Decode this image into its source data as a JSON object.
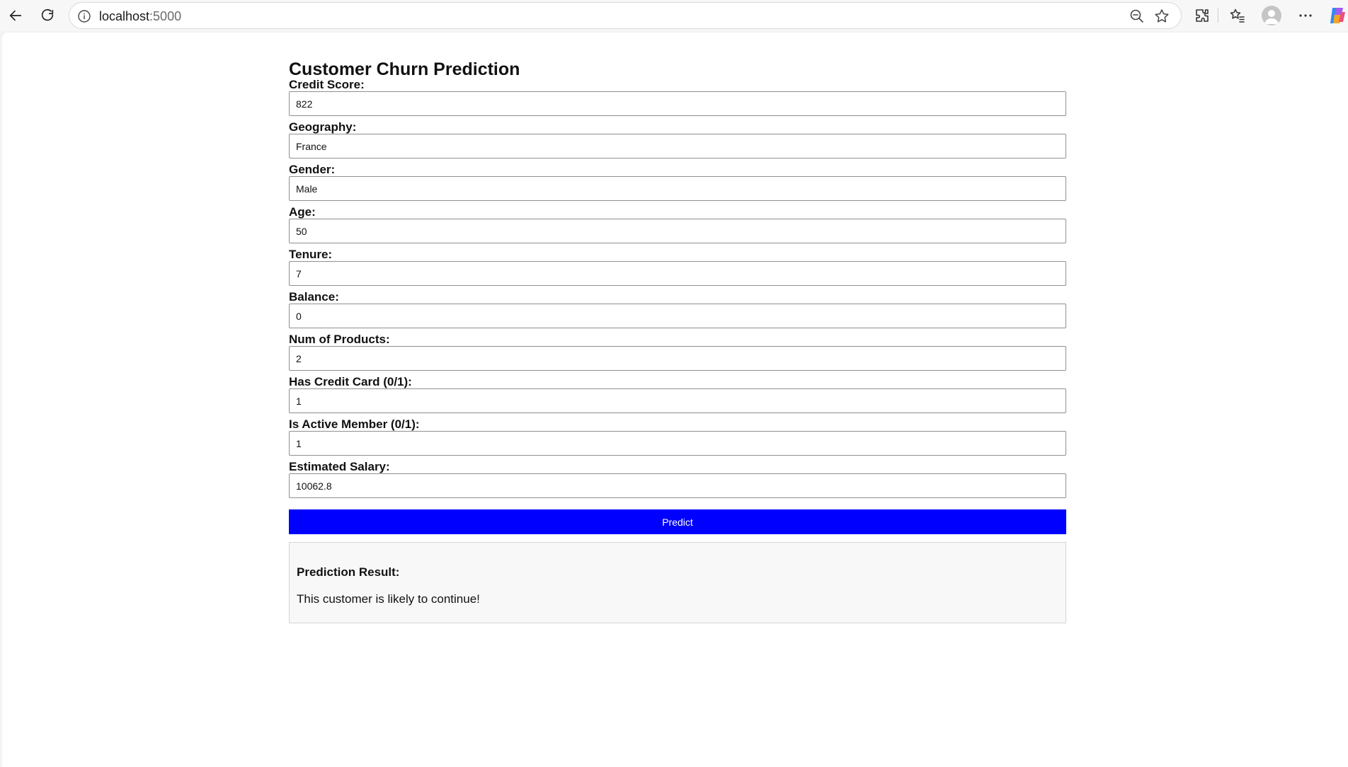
{
  "browser": {
    "url_host": "localhost",
    "url_port": ":5000"
  },
  "form": {
    "title": "Customer Churn Prediction",
    "fields": [
      {
        "label": "Credit Score:",
        "value": "822"
      },
      {
        "label": "Geography:",
        "value": "France"
      },
      {
        "label": "Gender:",
        "value": "Male"
      },
      {
        "label": "Age:",
        "value": "50"
      },
      {
        "label": "Tenure:",
        "value": "7"
      },
      {
        "label": "Balance:",
        "value": "0"
      },
      {
        "label": "Num of Products:",
        "value": "2"
      },
      {
        "label": "Has Credit Card (0/1):",
        "value": "1"
      },
      {
        "label": "Is Active Member (0/1):",
        "value": "1"
      },
      {
        "label": "Estimated Salary:",
        "value": "10062.8"
      }
    ],
    "submit_label": "Predict",
    "submit_color": "#0000ff"
  },
  "result": {
    "heading": "Prediction Result:",
    "message": "This customer is likely to continue!"
  }
}
